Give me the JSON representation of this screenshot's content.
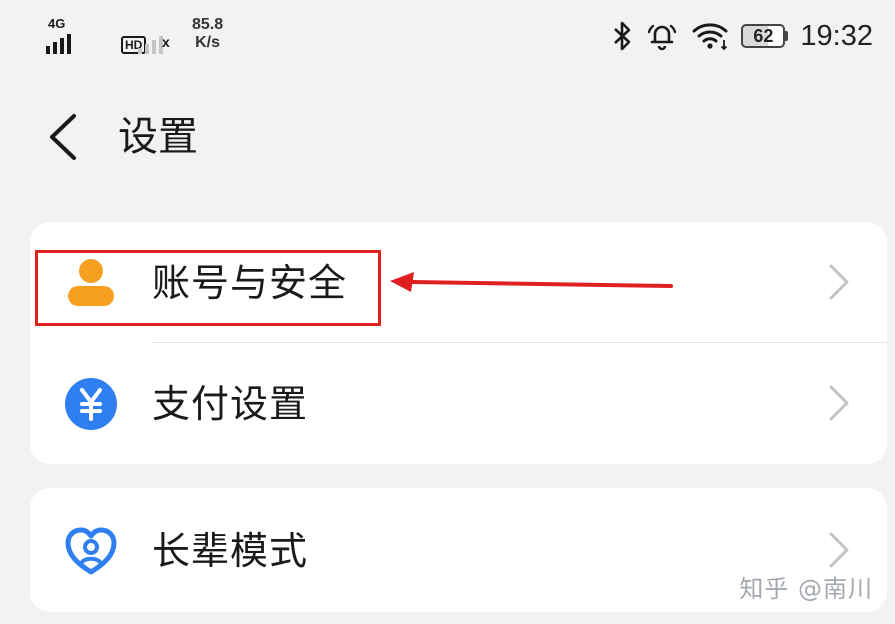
{
  "status_bar": {
    "network_type": "4G",
    "hd_badge": "HD",
    "sim2_status": "x",
    "speed_value": "85.8",
    "speed_unit": "K/s",
    "battery_level": "62",
    "time": "19:32",
    "icons": [
      "bluetooth-icon",
      "bell-icon",
      "wifi-icon",
      "battery-icon"
    ]
  },
  "header": {
    "title": "设置",
    "back_icon": "chevron-left-icon"
  },
  "settings": {
    "group1": [
      {
        "label": "账号与安全",
        "icon": "user-icon",
        "icon_color": "#f5a020"
      },
      {
        "label": "支付设置",
        "icon": "yen-icon",
        "icon_color": "#2f7ff0"
      }
    ],
    "group2": [
      {
        "label": "长辈模式",
        "icon": "heart-person-icon",
        "icon_color": "#2f7ff0"
      }
    ]
  },
  "annotation": {
    "highlight_color": "#e02020"
  },
  "watermark": "知乎 @南川"
}
